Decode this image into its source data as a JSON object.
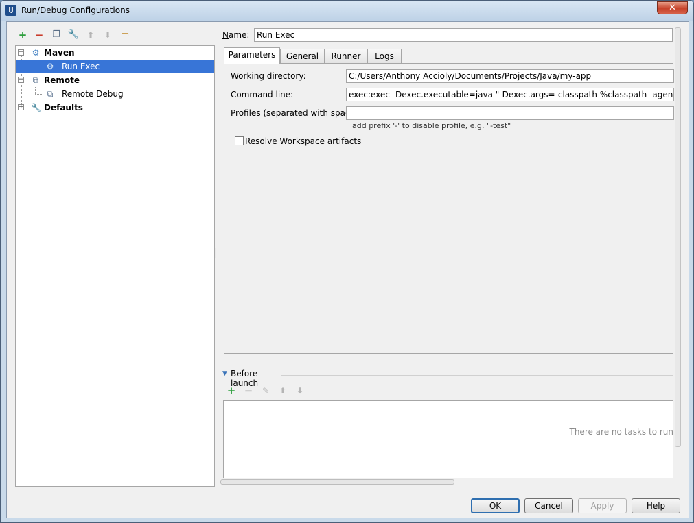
{
  "window": {
    "title": "Run/Debug Configurations",
    "close_glyph": "✕"
  },
  "left_toolbar": {
    "icons": [
      "add-icon",
      "remove-icon",
      "copy-icon",
      "edit-defaults-icon",
      "move-up-icon",
      "move-down-icon",
      "folder-icon"
    ]
  },
  "tree": {
    "maven": {
      "label": "Maven"
    },
    "run_exec": {
      "label": "Run Exec"
    },
    "remote": {
      "label": "Remote"
    },
    "remote_debug": {
      "label": "Remote Debug"
    },
    "defaults": {
      "label": "Defaults"
    }
  },
  "name_field": {
    "label": "Name:",
    "value": "Run Exec"
  },
  "tabs": [
    "Parameters",
    "General",
    "Runner",
    "Logs"
  ],
  "parameters": {
    "working_directory": {
      "label": "Working directory:",
      "value": "C:/Users/Anthony Accioly/Documents/Projects/Java/my-app"
    },
    "command_line": {
      "label": "Command line:",
      "value": "exec:exec -Dexec.executable=java \"-Dexec.args=-classpath %classpath -agentlib:jdwp=tran"
    },
    "profiles": {
      "label": "Profiles (separated with space):",
      "value": "",
      "hint": "add prefix '-' to disable profile, e.g. \"-test\""
    },
    "resolve_workspace": {
      "label": "Resolve Workspace artifacts",
      "checked": false
    }
  },
  "before_launch": {
    "title": "Before launch",
    "empty_text": "There are no tasks to run"
  },
  "buttons": {
    "ok": "OK",
    "cancel": "Cancel",
    "apply": "Apply",
    "help": "Help"
  },
  "colors": {
    "selection": "#3875d7",
    "add": "#2e9e3e",
    "remove": "#c93b2b"
  }
}
